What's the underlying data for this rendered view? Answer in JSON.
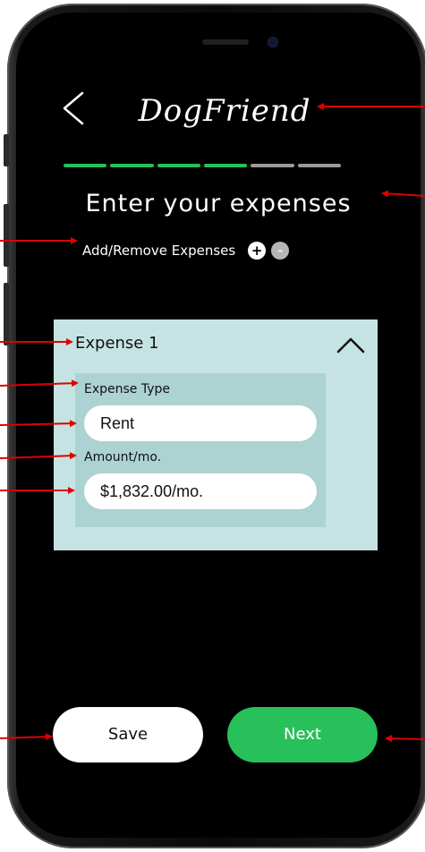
{
  "app": {
    "logo_text": "DogFriend"
  },
  "progress": {
    "total_steps": 6,
    "completed_steps": 4,
    "active_color": "#27c05a",
    "inactive_color": "#9a9a9a"
  },
  "page": {
    "title": "Enter your expenses"
  },
  "expense_controls": {
    "label": "Add/Remove Expenses",
    "add_symbol": "+",
    "remove_symbol": "-"
  },
  "expense_card": {
    "title": "Expense 1",
    "type_label": "Expense Type",
    "type_value": "Rent",
    "amount_label": "Amount/mo.",
    "amount_value": "$1,832.00/mo."
  },
  "actions": {
    "save_label": "Save",
    "next_label": "Next"
  },
  "colors": {
    "background": "#000000",
    "card": "#c6e3e3",
    "card_inner": "#acd2d2",
    "accent_green": "#27c05a",
    "annotation_red": "#e00000"
  }
}
